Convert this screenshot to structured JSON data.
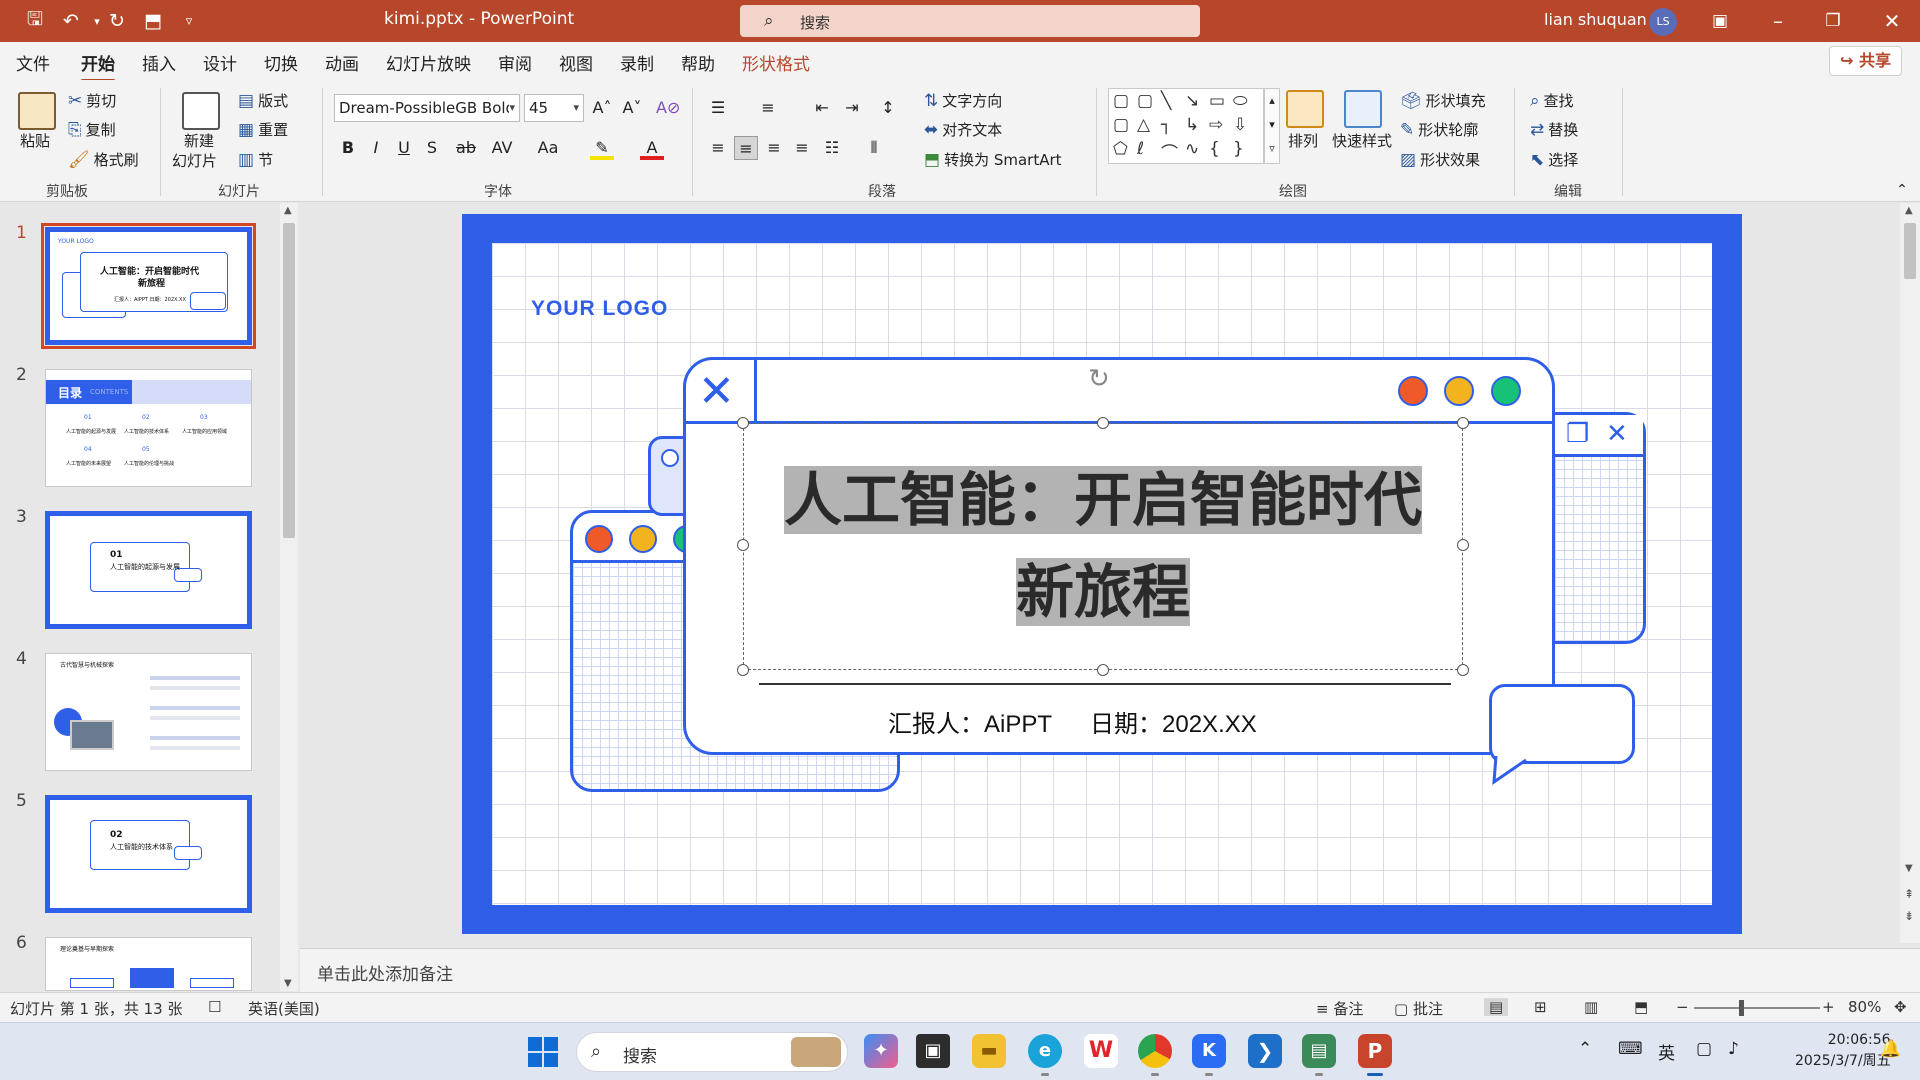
{
  "titlebar": {
    "filename": "kimi.pptx",
    "separator": "-",
    "app": "PowerPoint",
    "search_placeholder": "搜索",
    "user": "lian shuquan",
    "avatar_initials": "LS"
  },
  "menu": {
    "items": [
      "文件",
      "开始",
      "插入",
      "设计",
      "切换",
      "动画",
      "幻灯片放映",
      "审阅",
      "视图",
      "录制",
      "帮助",
      "形状格式"
    ],
    "active": "开始",
    "share": "共享"
  },
  "ribbon": {
    "clipboard": {
      "paste": "粘贴",
      "cut": "剪切",
      "copy": "复制",
      "format_painter": "格式刷",
      "label": "剪贴板"
    },
    "slides": {
      "new_slide_1": "新建",
      "new_slide_2": "幻灯片",
      "layout": "版式",
      "reset": "重置",
      "section": "节",
      "label": "幻灯片"
    },
    "font": {
      "name": "Dream-PossibleGB Bold",
      "size": "45",
      "label": "字体"
    },
    "paragraph": {
      "text_direction": "文字方向",
      "align_text": "对齐文本",
      "smartart": "转换为 SmartArt",
      "label": "段落"
    },
    "drawing": {
      "arrange": "排列",
      "quick_styles": "快速样式",
      "shape_fill": "形状填充",
      "shape_outline": "形状轮廓",
      "shape_effects": "形状效果",
      "label": "绘图"
    },
    "editing": {
      "find": "查找",
      "replace": "替换",
      "select": "选择",
      "label": "编辑"
    }
  },
  "thumbnails": [
    {
      "num": "1",
      "title_line1": "人工智能：开启智能时代",
      "title_line2": "新旅程",
      "logo": "YOUR LOGO",
      "sub": "汇报人：AiPPT 日期：202X.XX"
    },
    {
      "num": "2",
      "heading": "目录",
      "heading_en": "CONTENTS",
      "items": [
        "人工智能的起源与发展",
        "人工智能的技术体系",
        "人工智能的应用领域",
        "人工智能的未来展望",
        "人工智能的伦理与挑战"
      ],
      "nums": [
        "01",
        "02",
        "03",
        "04",
        "05"
      ]
    },
    {
      "num": "3",
      "sec": "01",
      "title": "人工智能的起源与发展"
    },
    {
      "num": "4",
      "title": "古代智慧与机械探索"
    },
    {
      "num": "5",
      "sec": "02",
      "title": "人工智能的技术体系"
    },
    {
      "num": "6",
      "title": "理论奠基与早期探索"
    }
  ],
  "slide": {
    "logo": "YOUR LOGO",
    "title_line1": "人工智能：开启智能时代",
    "title_line2": "新旅程",
    "reporter": "汇报人：AiPPT",
    "date": "日期：202X.XX"
  },
  "notes_placeholder": "单击此处添加备注",
  "status": {
    "slide_info": "幻灯片 第 1 张，共 13 张",
    "language": "英语(美国)",
    "notes": "备注",
    "comments": "批注",
    "zoom": "80%"
  },
  "taskbar": {
    "search_placeholder": "搜索",
    "ime": "英",
    "time": "20:06:56",
    "date": "2025/3/7/周五"
  },
  "colors": {
    "accent": "#b7472a",
    "slide_blue": "#2f5fe8",
    "dot_red": "#f05a28",
    "dot_yellow": "#f2b31f",
    "dot_green": "#18c178"
  }
}
